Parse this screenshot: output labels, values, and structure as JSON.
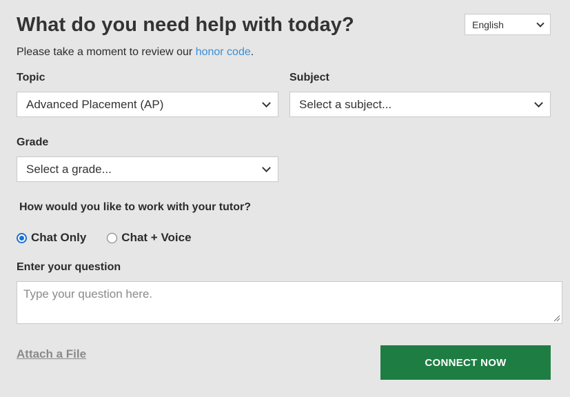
{
  "header": {
    "title": "What do you need help with today?",
    "language_selected": "English"
  },
  "intro": {
    "text_before_link": "Please take a moment to review our ",
    "link_text": "honor code",
    "text_after_link": "."
  },
  "form": {
    "topic": {
      "label": "Topic",
      "selected": "Advanced Placement (AP)"
    },
    "subject": {
      "label": "Subject",
      "selected": "Select a subject..."
    },
    "grade": {
      "label": "Grade",
      "selected": "Select a grade..."
    },
    "mode": {
      "prompt": "How would you like to work with your tutor?",
      "options": [
        {
          "label": "Chat Only",
          "checked": true
        },
        {
          "label": "Chat + Voice",
          "checked": false
        }
      ]
    },
    "question": {
      "label": "Enter your question",
      "placeholder": "Type your question here."
    },
    "attach_label": "Attach a File",
    "connect_label": "CONNECT NOW"
  },
  "colors": {
    "background": "#e6e6e6",
    "link": "#3a8fd6",
    "primary_button": "#1e7d43",
    "radio_accent": "#1f6fd1"
  },
  "icons": {
    "dropdown": "chevron-down-icon",
    "resize": "resize-handle-icon"
  }
}
